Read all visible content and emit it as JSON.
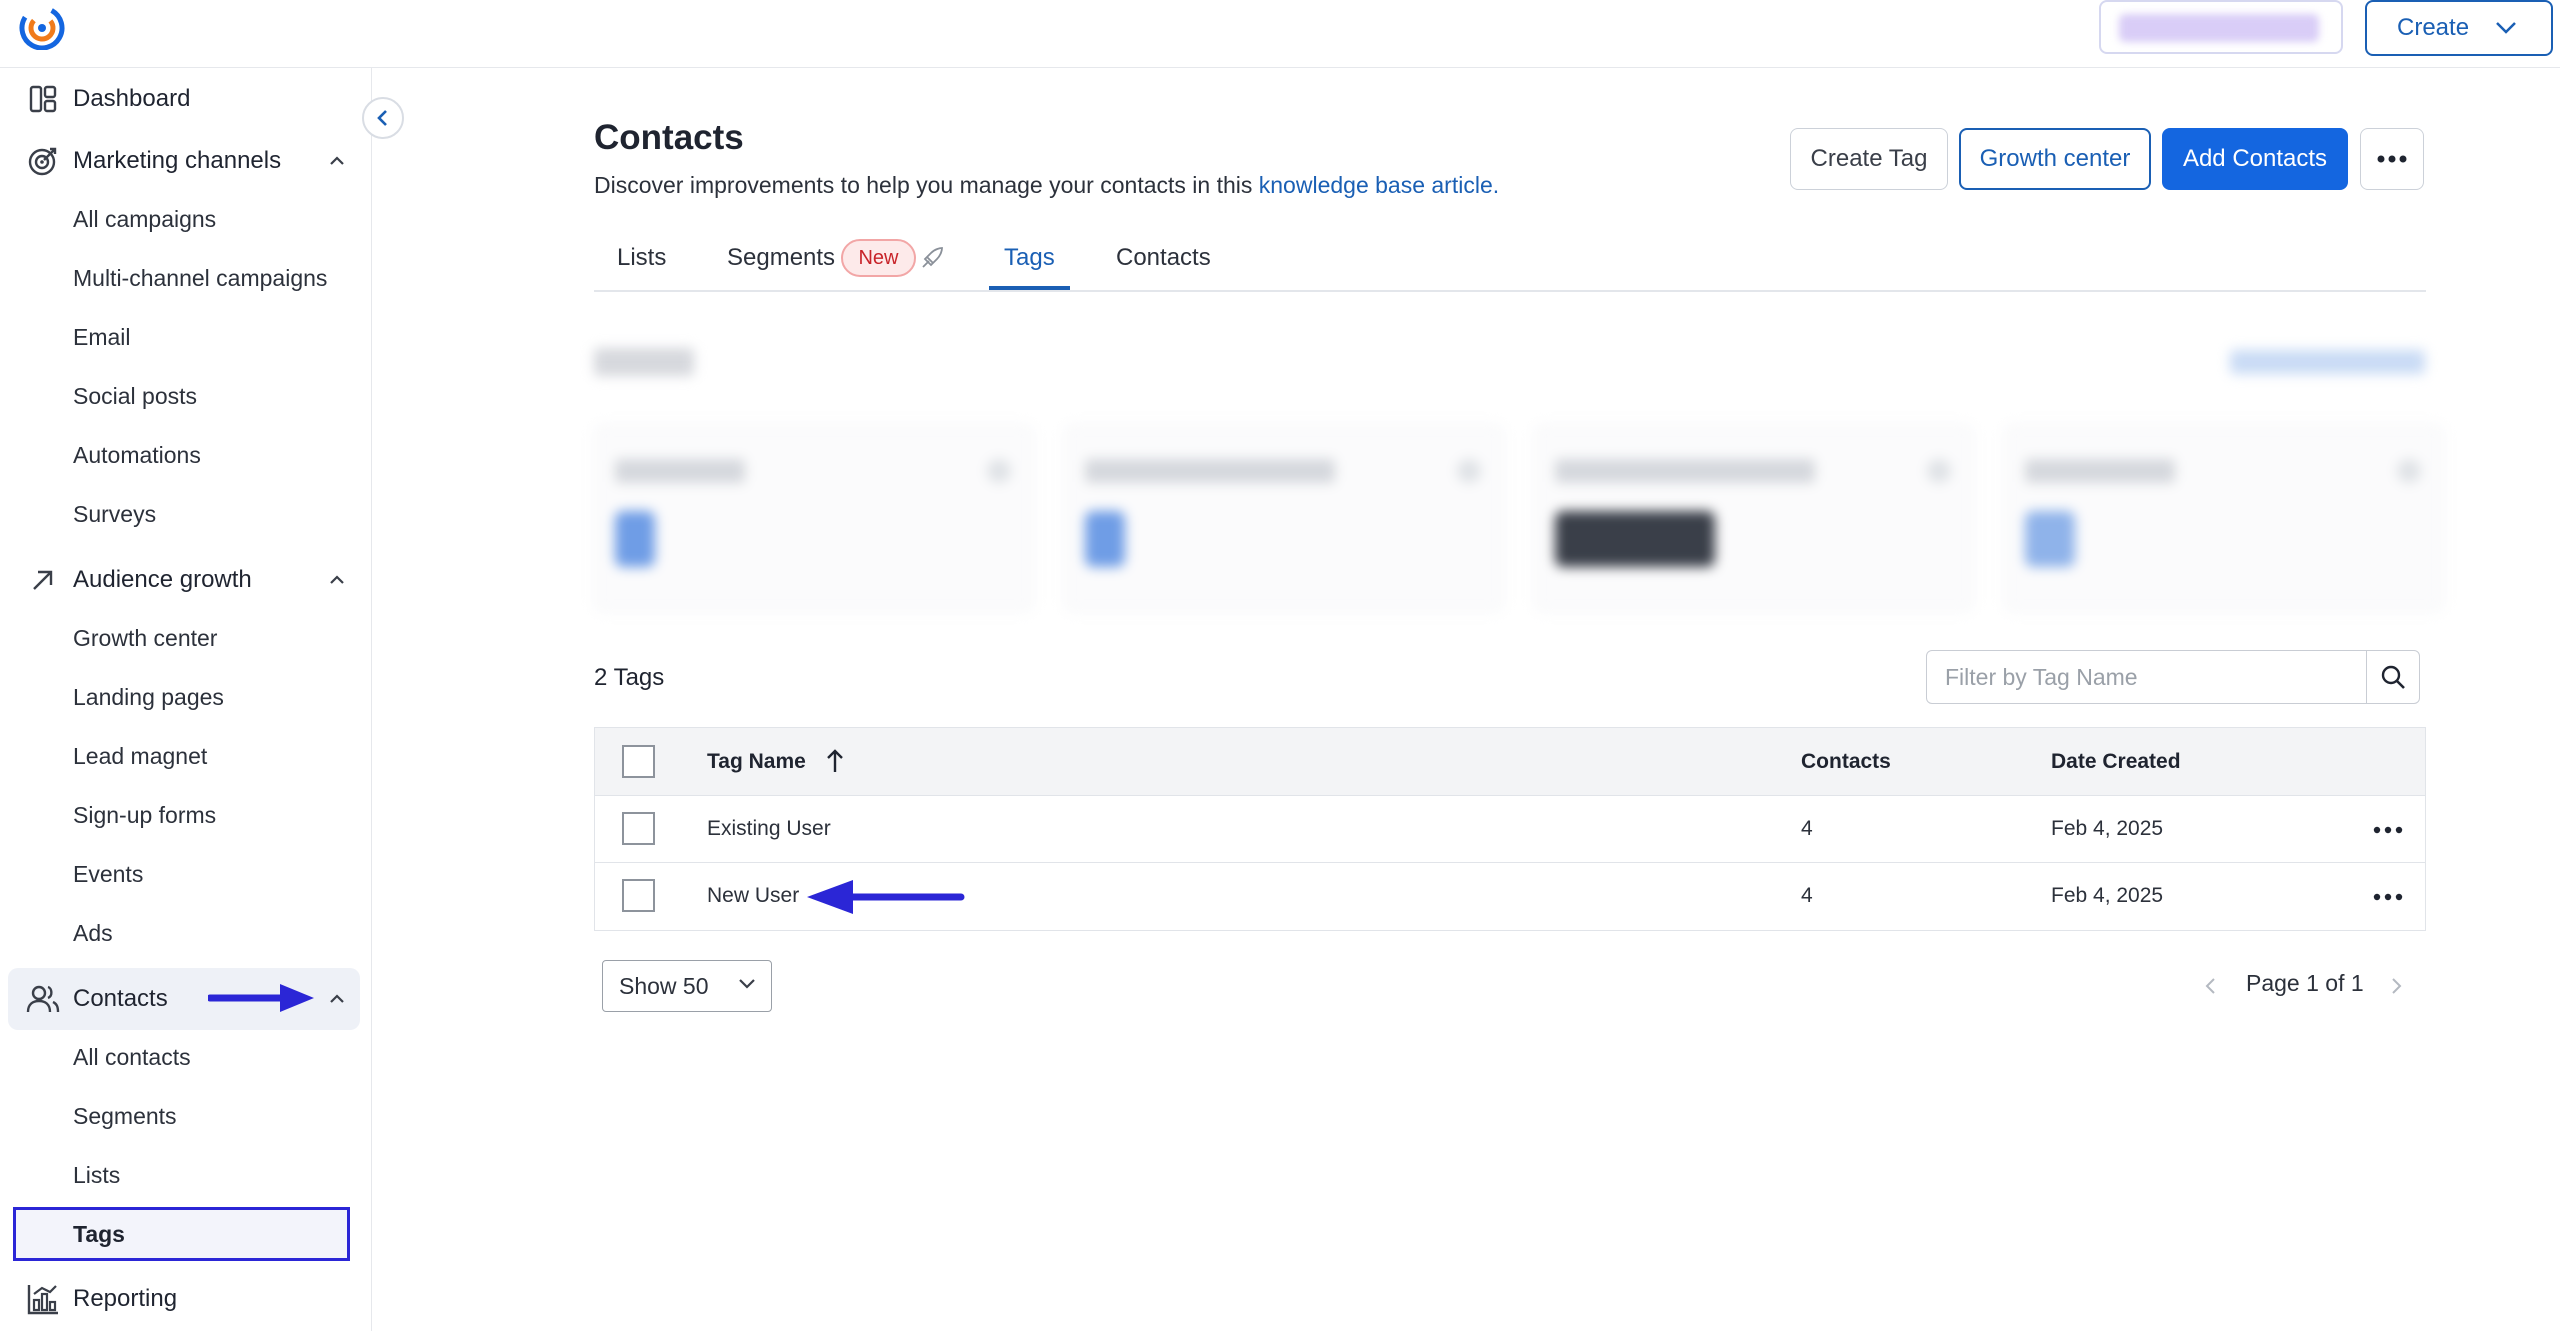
{
  "topbar": {
    "create_label": "Create"
  },
  "sidebar": {
    "dashboard": "Dashboard",
    "marketing_channels": "Marketing channels",
    "marketing_items": [
      "All campaigns",
      "Multi-channel campaigns",
      "Email",
      "Social posts",
      "Automations",
      "Surveys"
    ],
    "audience_growth": "Audience growth",
    "audience_items": [
      "Growth center",
      "Landing pages",
      "Lead magnet",
      "Sign-up forms",
      "Events",
      "Ads"
    ],
    "contacts": "Contacts",
    "contacts_items": [
      "All contacts",
      "Segments",
      "Lists",
      "Tags"
    ],
    "reporting": "Reporting"
  },
  "header": {
    "title": "Contacts",
    "description_prefix": "Discover improvements to help you manage your contacts in this ",
    "description_link": "knowledge base article.",
    "create_tag": "Create Tag",
    "growth_center": "Growth center",
    "add_contacts": "Add Contacts"
  },
  "tabs": {
    "lists": "Lists",
    "segments": "Segments",
    "segments_badge": "New",
    "tags": "Tags",
    "contacts": "Contacts"
  },
  "tags_section": {
    "count_label": "2 Tags",
    "filter_placeholder": "Filter by Tag Name"
  },
  "table": {
    "columns": {
      "name": "Tag Name",
      "contacts": "Contacts",
      "date": "Date Created"
    },
    "rows": [
      {
        "name": "Existing User",
        "contacts": "4",
        "date": "Feb 4, 2025"
      },
      {
        "name": "New User",
        "contacts": "4",
        "date": "Feb 4, 2025"
      }
    ]
  },
  "footer": {
    "show_label": "Show 50",
    "page_label": "Page 1 of 1"
  },
  "colors": {
    "accent": "#1a5fb4",
    "primary_button": "#1466e0",
    "annotation": "#2b26d6",
    "new_badge": "#c8242a"
  }
}
